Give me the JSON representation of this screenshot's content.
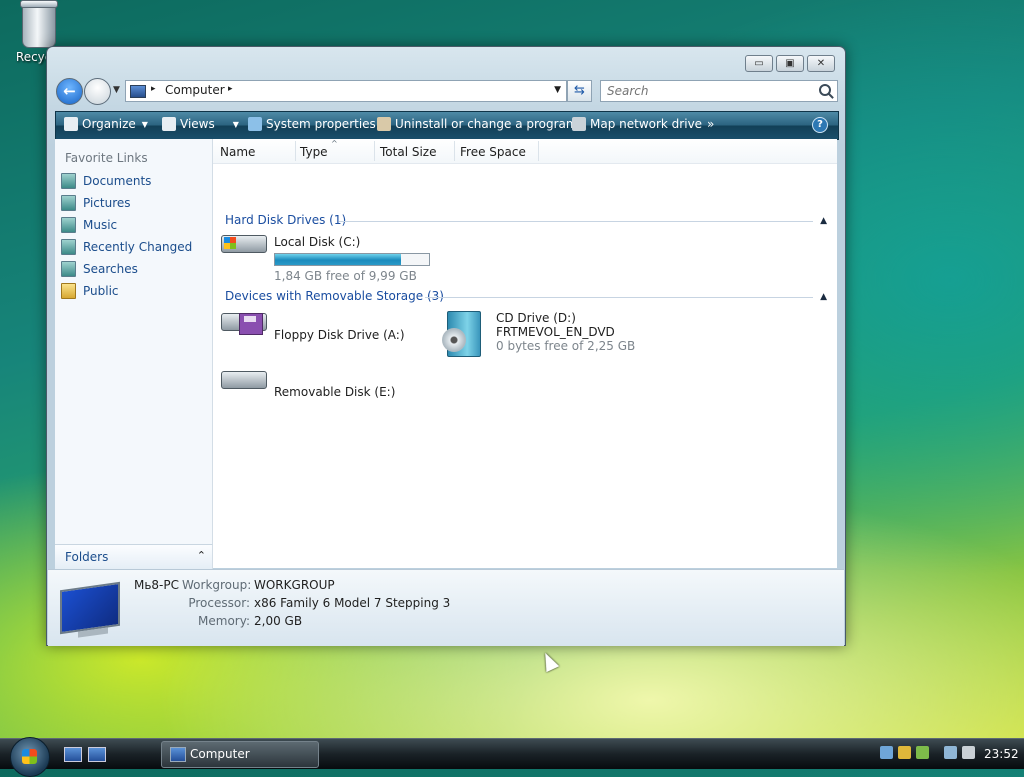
{
  "desktop": {
    "recycle_bin_label": "Recycle"
  },
  "window": {
    "buttons": {
      "minimize": "▭",
      "maximize": "▣",
      "close": "✕"
    },
    "address": {
      "location": "Computer",
      "separator": "▸"
    },
    "search": {
      "placeholder": "Search"
    },
    "toolbar": {
      "organize": "Organize",
      "views": "Views",
      "system_properties": "System properties",
      "uninstall": "Uninstall or change a program",
      "map_drive": "Map network drive",
      "more": "»",
      "help": "?"
    },
    "nav_pane": {
      "header": "Favorite Links",
      "links": [
        "Documents",
        "Pictures",
        "Music",
        "Recently Changed",
        "Searches",
        "Public"
      ],
      "folders_label": "Folders",
      "folders_chevron": "⌃"
    },
    "columns": [
      "Name",
      "Type",
      "Total Size",
      "Free Space"
    ],
    "groups": {
      "hard_disks": {
        "title": "Hard Disk Drives (1)",
        "items": [
          {
            "name": "Local Disk (C:)",
            "space": "1,84 GB free of 9,99 GB",
            "used_fraction": 0.82
          }
        ]
      },
      "removable": {
        "title": "Devices with Removable Storage (3)",
        "items": [
          {
            "name": "Floppy Disk Drive (A:)"
          },
          {
            "name": "CD Drive (D:)",
            "label": "FRTMEVOL_EN_DVD",
            "space": "0 bytes free of 2,25 GB"
          },
          {
            "name": "Removable Disk (E:)"
          }
        ]
      }
    },
    "details": {
      "computer_name": "Мь8-PC",
      "workgroup_label": "Workgroup:",
      "workgroup": "WORKGROUP",
      "processor_label": "Processor:",
      "processor": "x86 Family 6 Model 7 Stepping 3",
      "memory_label": "Memory:",
      "memory": "2,00 GB"
    }
  },
  "taskbar": {
    "active_window": "Computer",
    "clock": "23:52"
  }
}
